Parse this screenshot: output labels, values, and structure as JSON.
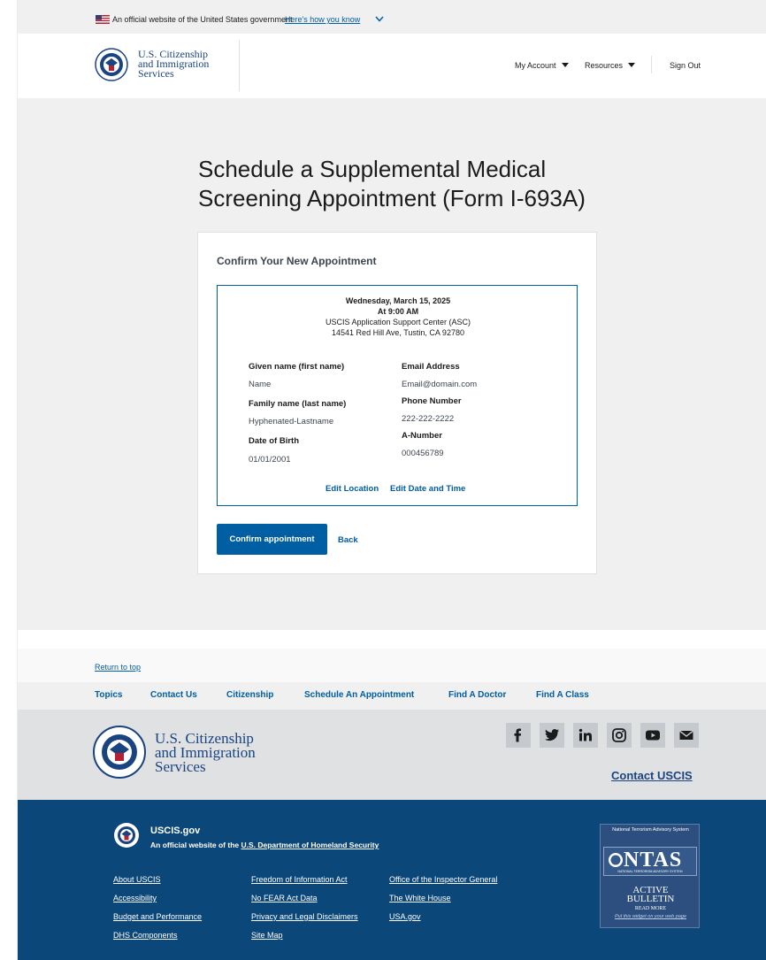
{
  "gov_banner": {
    "official_text": "An official website of the United States government",
    "how_text": "Here's how you know"
  },
  "header": {
    "agency_lines": [
      "U.S. Citizenship",
      "and Immigration",
      "Services"
    ],
    "nav": {
      "my_account": "My Account",
      "resources": "Resources",
      "sign_out": "Sign Out"
    }
  },
  "main": {
    "title_lines": [
      "Schedule a Supplemental Medical",
      "Screening Appointment (Form I-693A)"
    ],
    "card": {
      "heading": "Confirm Your New Appointment",
      "appointment": {
        "date": "Wednesday, March 15, 2025",
        "time": "At 9:00 AM",
        "location": "USCIS Application Support Center (ASC)",
        "address": "14541 Red Hill Ave, Tustin, CA 92780"
      },
      "fields": {
        "given_name_label": "Given name (first name)",
        "given_name_value": "Name",
        "family_name_label": "Family name (last name)",
        "family_name_value": "Hyphenated-Lastname",
        "dob_label": "Date of Birth",
        "dob_value": "01/01/2001",
        "email_label": "Email Address",
        "email_value": "Email@domain.com",
        "phone_label": "Phone Number",
        "phone_value": "222-222-2222",
        "anumber_label": "A-Number",
        "anumber_value": "000456789"
      },
      "edit_location": "Edit Location",
      "edit_datetime": "Edit Date and Time",
      "confirm_button": "Confirm appointment",
      "back_button": "Back"
    }
  },
  "footer": {
    "return_to_top": "Return to top",
    "topics": [
      "Topics",
      "Contact Us",
      "Citizenship",
      "Schedule An Appointment",
      "Find A Doctor",
      "Find A Class"
    ],
    "agency_lines": [
      "U.S. Citizenship",
      "and Immigration",
      "Services"
    ],
    "social_icons": [
      "facebook-icon",
      "twitter-icon",
      "linkedin-icon",
      "instagram-icon",
      "youtube-icon",
      "email-icon"
    ],
    "contact_link": "Contact USCIS",
    "site_name": "USCIS.gov",
    "official_prefix": "An official website of the ",
    "dhs_link": "U.S. Department of Homeland Security",
    "links_col1": [
      "About USCIS",
      "Accessibility",
      "Budget and Performance",
      "DHS Components"
    ],
    "links_col2": [
      "Freedom of Information Act",
      "No FEAR Act Data",
      "Privacy and Legal Disclaimers",
      "Site Map"
    ],
    "links_col3": [
      "Office of the Inspector General",
      "The White House",
      "USA.gov"
    ],
    "ntas": {
      "top": "National Terrorism Advisory System",
      "logo": "NTAS",
      "sub": "NATIONAL TERRORISM ADVISORY SYSTEM",
      "status_line1": "ACTIVE",
      "status_line2": "BULLETIN",
      "read_more": "READ MORE",
      "widget": "Put this widget on your web page"
    }
  },
  "colors": {
    "primary": "#005ea2",
    "dark_footer": "#0b4778",
    "agency_navy": "#1a4480"
  }
}
